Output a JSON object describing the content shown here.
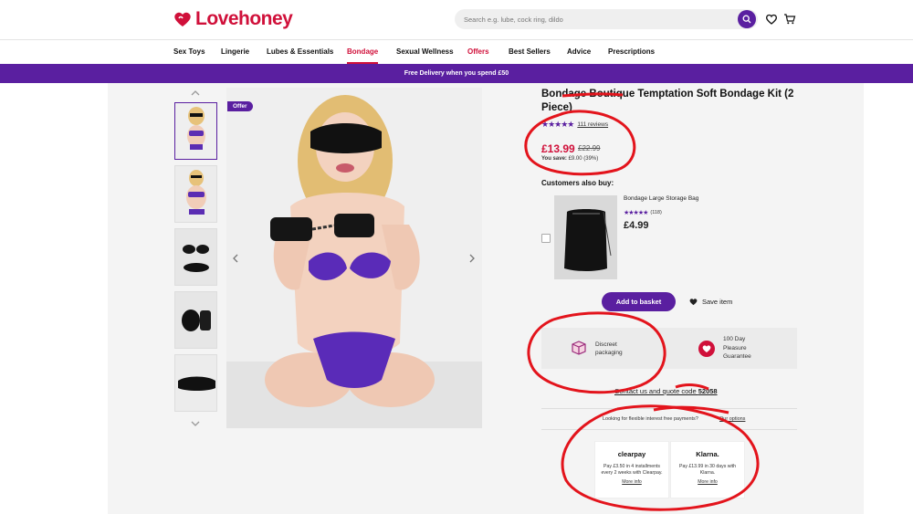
{
  "header": {
    "logo_text": "Lovehoney",
    "search_placeholder": "Search e.g. lube, cock ring, dildo"
  },
  "nav": {
    "items": [
      "Sex Toys",
      "Lingerie",
      "Lubes & Essentials",
      "Bondage",
      "Sexual Wellness",
      "Offers",
      "Best Sellers",
      "Advice",
      "Prescriptions"
    ]
  },
  "promo": {
    "text": "Free Delivery when you spend £50"
  },
  "gallery": {
    "badge": "Offer"
  },
  "product": {
    "title": "Bondage Boutique Temptation Soft Bondage Kit (2 Piece)",
    "rating": 4.5,
    "reviews": "111 reviews",
    "price": "£13.99",
    "was_price": "£22.99",
    "save_label": "You save:",
    "save_value": "£9.00 (39%)"
  },
  "also_buy": {
    "heading": "Customers also buy:",
    "name": "Bondage Large Storage Bag",
    "rating": 4.5,
    "count": "(118)",
    "price": "£4.99"
  },
  "actions": {
    "basket": "Add to basket",
    "save_item": "Save item"
  },
  "features": {
    "discreet": "Discreet packaging",
    "guarantee": "100 Day Pleasure Guarantee"
  },
  "contact": {
    "text": "Contact us and quote code ",
    "code": "52058"
  },
  "finance": {
    "question": "Looking for flexible interest free payments?",
    "link": "Our options"
  },
  "clearpay": {
    "logo": "clearpay",
    "text": "Pay £3.50 in 4 installments every 2 weeks with Clearpay.",
    "more": "More info"
  },
  "klarna": {
    "logo": "Klarna.",
    "text": "Pay £13.99 in 30 days with Klarna.",
    "more": "More info"
  },
  "colors": {
    "brand_red": "#d0103a",
    "brand_purple": "#5a1fa0",
    "annotation_red": "#e3141c"
  }
}
